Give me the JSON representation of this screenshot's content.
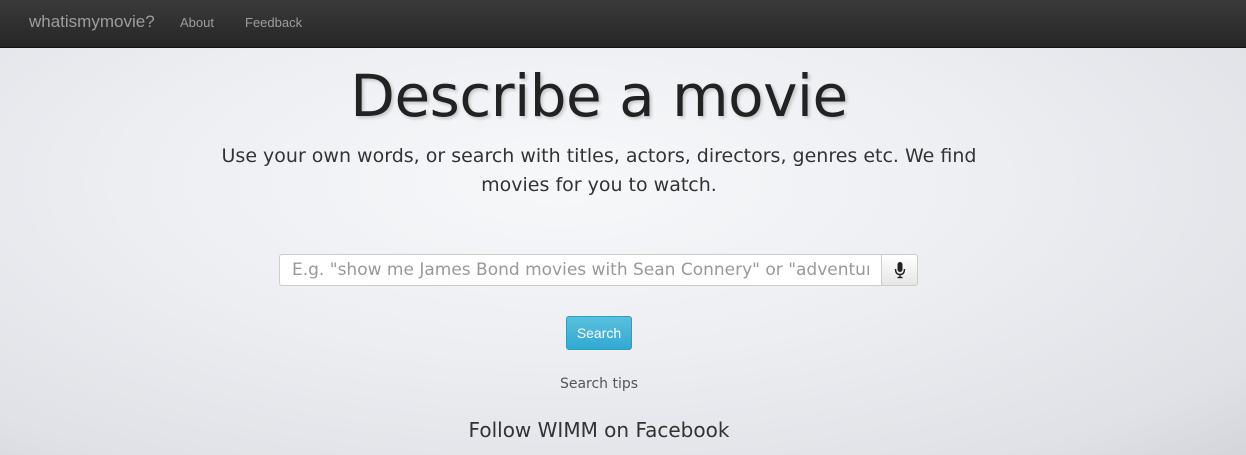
{
  "navbar": {
    "brand": "whatismymovie?",
    "links": [
      {
        "label": "About"
      },
      {
        "label": "Feedback"
      }
    ]
  },
  "hero": {
    "title": "Describe a movie",
    "subtitle": "Use your own words, or search with titles, actors, directors, genres etc. We find movies for you to watch."
  },
  "search": {
    "placeholder": "E.g. \"show me James Bond movies with Sean Connery\" or \"adventure m",
    "value": "",
    "mic_icon": "microphone-icon",
    "button_label": "Search"
  },
  "footer": {
    "tips_label": "Search tips",
    "follow_label": "Follow WIMM on Facebook"
  },
  "colors": {
    "navbar": "#2b2b2b",
    "nav_text": "#9d9d9d",
    "button": "#3fb3d9",
    "text": "#222222"
  }
}
